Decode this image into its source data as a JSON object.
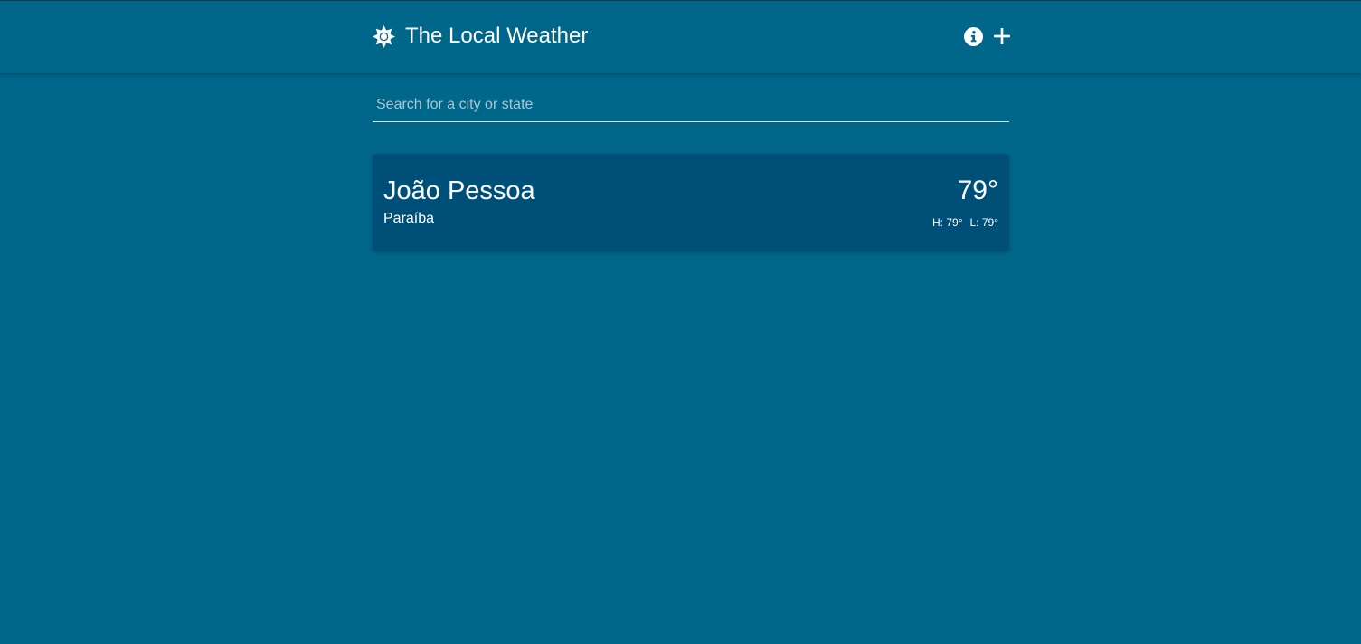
{
  "header": {
    "title": "The Local Weather",
    "logo_icon": "sun-icon",
    "info_icon": "info-icon",
    "add_icon": "plus-icon"
  },
  "search": {
    "placeholder": "Search for a city or state",
    "value": ""
  },
  "cities": [
    {
      "name": "João Pessoa",
      "state": "Paraíba",
      "temperature": "79°",
      "high": "H: 79°",
      "low": "L: 79°"
    }
  ],
  "colors": {
    "background": "#00668a",
    "card": "#004f78",
    "text": "#ffffff"
  }
}
